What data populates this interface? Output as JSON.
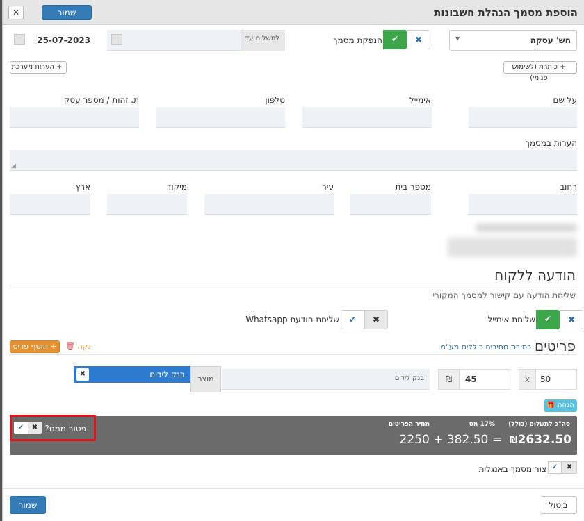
{
  "header": {
    "title": "הוספת מסמך הנהלת חשבונות",
    "close": "✕",
    "save": "שמור"
  },
  "doc": {
    "type_select": "חש' עסקה",
    "issue_label": "הנפקת מסמך",
    "pay_until_placeholder": "לתשלום עד",
    "date": "25-07-2023",
    "add_title": "+ כותרת (לשימוש פנימי)",
    "add_system_notes": "+ הערות מערכת"
  },
  "client": {
    "name_label": "על שם",
    "email_label": "אימייל",
    "phone_label": "טלפון",
    "id_label": "ת. זהות / מספר עסק",
    "notes_label": "הערות במסמך",
    "street_label": "רחוב",
    "house_label": "מספר בית",
    "city_label": "עיר",
    "zip_label": "מיקוד",
    "country_label": "ארץ"
  },
  "notify": {
    "title": "הודעה ללקוח",
    "subtitle": "שליחת הודעה עם קישור למסמך המקורי",
    "email_label": "שליחת אימייל",
    "whatsapp_label": "שליחת הודעת Whatsapp"
  },
  "items": {
    "title": "פריטים",
    "vat_link": "כתיבת מחירים כוללים מע\"מ",
    "add_item": "+ הוסף פריט",
    "clean": "נקה",
    "product_chip": "בנק לידים",
    "product_label": "מוצר",
    "description": "בנק לידים",
    "currency": "₪",
    "price": "45",
    "qty_x": "x",
    "qty": "50",
    "discount_btn": "הנחה"
  },
  "totals": {
    "total_label": "סה\"כ לתשלום (כולל)",
    "tax_label": "17% מס",
    "items_price_label": "מחיר הפריטים",
    "total_value": "2632.50",
    "currency": "₪",
    "breakdown": "2250 + 382.50 =",
    "tax_exempt_label": "פטור ממס?"
  },
  "footer": {
    "english_label": "צור מסמך באנגלית",
    "save": "שמור",
    "cancel": "ביטול"
  },
  "colors": {
    "primary": "#337ab7",
    "success": "#3ea64a",
    "orange": "#e69233",
    "highlight": "#e1141e"
  }
}
